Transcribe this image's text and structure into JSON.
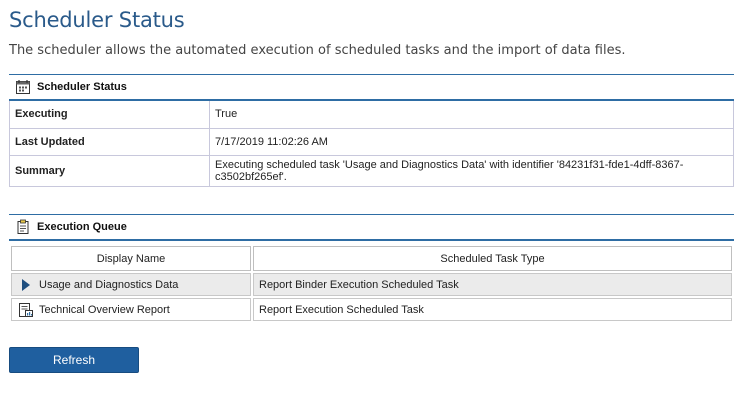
{
  "page": {
    "title": "Scheduler Status",
    "description": "The scheduler allows the automated execution of scheduled tasks and the import of data files."
  },
  "scheduler_status": {
    "header": "Scheduler Status",
    "icon": "calendar-icon",
    "rows": [
      {
        "label": "Executing",
        "value": "True"
      },
      {
        "label": "Last Updated",
        "value": "7/17/2019 11:02:26 AM"
      },
      {
        "label": "Summary",
        "value": "Executing scheduled task 'Usage and Diagnostics Data' with identifier '84231f31-fde1-4dff-8367-c3502bf265ef'."
      }
    ]
  },
  "execution_queue": {
    "header": "Execution Queue",
    "icon": "clipboard-icon",
    "columns": [
      "Display Name",
      "Scheduled Task Type"
    ],
    "rows": [
      {
        "name": "Usage and Diagnostics Data",
        "type": "Report Binder Execution Scheduled Task",
        "icon": "play-arrow-icon",
        "selected": true
      },
      {
        "name": "Technical Overview Report",
        "type": "Report Execution Scheduled Task",
        "icon": "report-icon",
        "selected": false
      }
    ]
  },
  "actions": {
    "refresh_label": "Refresh"
  },
  "colors": {
    "title": "#2a5a8a",
    "accent_line": "#2e6da4",
    "button": "#1f5f9f",
    "selected_row": "#ebebeb"
  }
}
